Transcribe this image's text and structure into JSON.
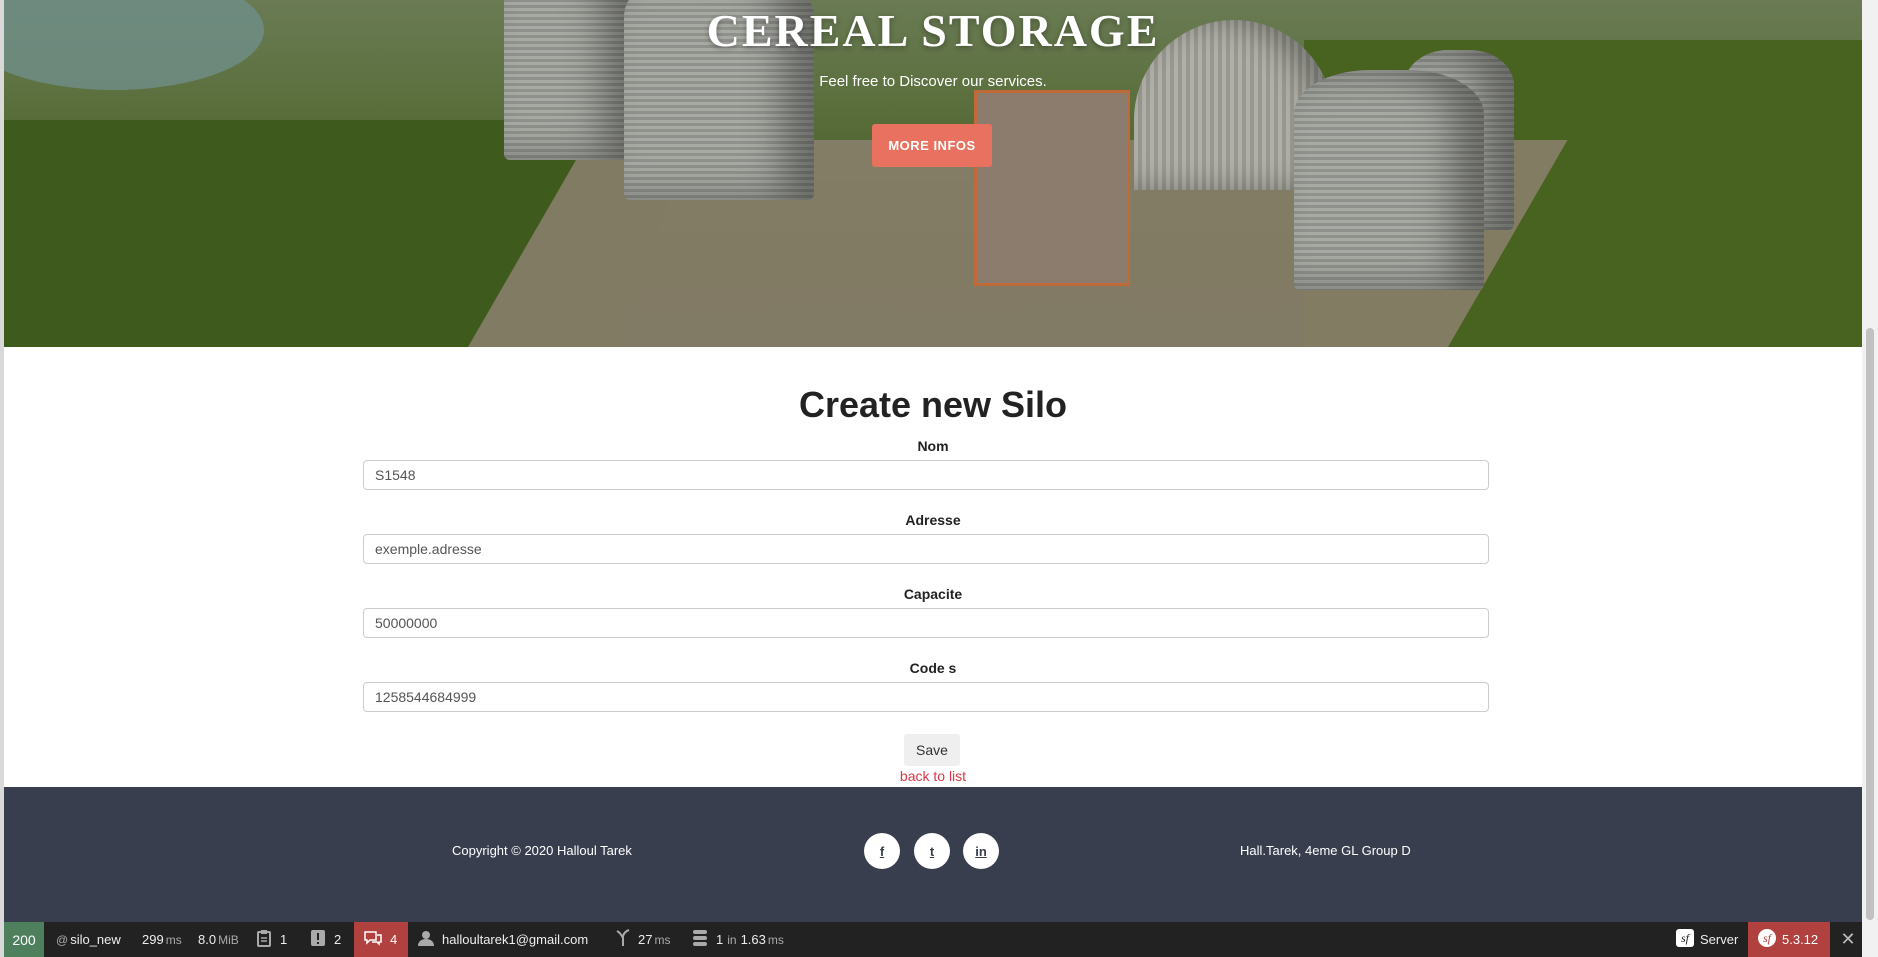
{
  "hero": {
    "title": "CEREAL STORAGE",
    "subtitle": "Feel free to Discover our services.",
    "button_label": "MORE INFOS"
  },
  "form": {
    "title": "Create new Silo",
    "fields": [
      {
        "label": "Nom",
        "value": "S1548"
      },
      {
        "label": "Adresse",
        "value": "exemple.adresse"
      },
      {
        "label": "Capacite",
        "value": "50000000"
      },
      {
        "label": "Code s",
        "value": "1258544684999"
      }
    ],
    "save_label": "Save",
    "back_label": "back to list"
  },
  "footer": {
    "copyright": "Copyright © 2020 Halloul Tarek",
    "right_text": "Hall.Tarek, 4eme GL Group D",
    "social": [
      "f",
      "t",
      "in"
    ]
  },
  "toolbar": {
    "status_code": "200",
    "route": "silo_new",
    "time_value": "299",
    "time_unit": "ms",
    "memory_value": "8.0",
    "memory_unit": "MiB",
    "forms_count": "1",
    "logs_count": "2",
    "messages_count": "4",
    "user": "halloultarek1@gmail.com",
    "twig_value": "27",
    "twig_unit": "ms",
    "db_queries": "1",
    "db_in": "in",
    "db_time": "1.63",
    "db_unit": "ms",
    "server_label": "Server",
    "symfony_version": "5.3.12",
    "status_color": "#4f805d",
    "alert_color": "#b0413e"
  }
}
